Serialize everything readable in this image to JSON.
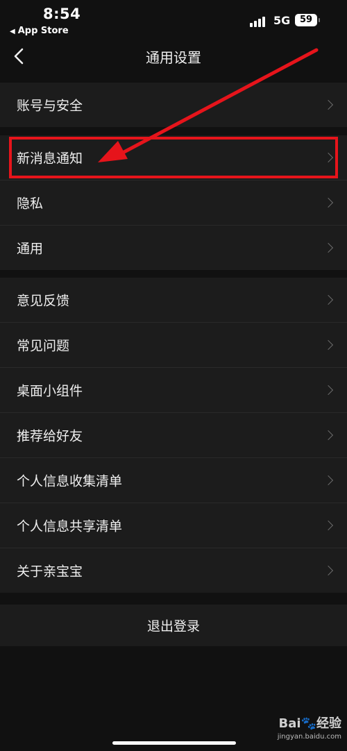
{
  "status_bar": {
    "time": "8:54",
    "back_app": "App Store",
    "network": "5G",
    "battery": "59"
  },
  "nav": {
    "title": "通用设置"
  },
  "groups": [
    {
      "items": [
        {
          "label": "账号与安全"
        }
      ]
    },
    {
      "items": [
        {
          "label": "新消息通知"
        },
        {
          "label": "隐私"
        },
        {
          "label": "通用"
        }
      ]
    },
    {
      "items": [
        {
          "label": "意见反馈"
        },
        {
          "label": "常见问题"
        },
        {
          "label": "桌面小组件"
        },
        {
          "label": "推荐给好友"
        },
        {
          "label": "个人信息收集清单"
        },
        {
          "label": "个人信息共享清单"
        },
        {
          "label": "关于亲宝宝"
        }
      ]
    }
  ],
  "logout": {
    "label": "退出登录"
  },
  "watermark": {
    "brand": "Bai",
    "brand_suffix": "经验",
    "site": "jingyan.baidu.com"
  },
  "colors": {
    "highlight": "#e6141b",
    "background": "#111111",
    "row_background": "#1c1c1c"
  }
}
